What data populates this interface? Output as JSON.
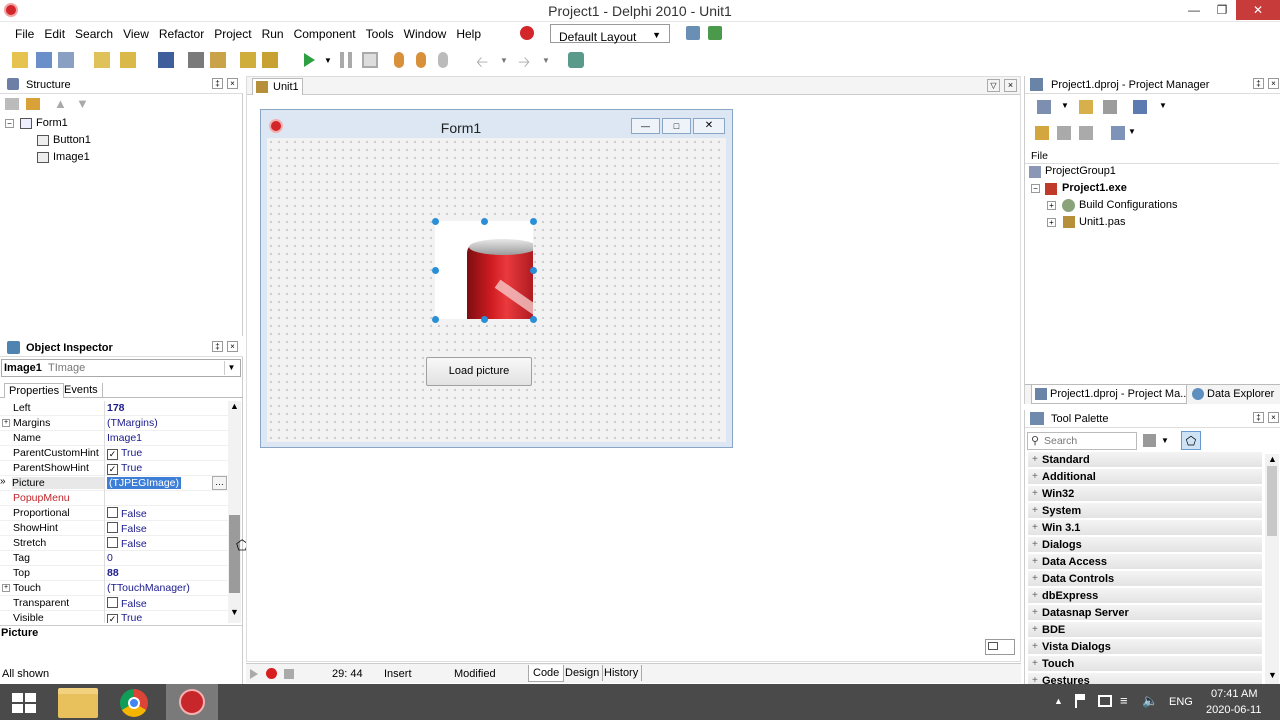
{
  "window": {
    "title": "Project1 - Delphi 2010 - Unit1"
  },
  "menu": [
    "File",
    "Edit",
    "Search",
    "View",
    "Refactor",
    "Project",
    "Run",
    "Component",
    "Tools",
    "Window",
    "Help"
  ],
  "layout_select": "Default Layout",
  "structure": {
    "title": "Structure",
    "root": "Form1",
    "children": [
      "Button1",
      "Image1"
    ]
  },
  "editor": {
    "tab": "Unit1",
    "form_caption": "Form1",
    "button_label": "Load picture"
  },
  "inspector": {
    "title": "Object Inspector",
    "selected_name": "Image1",
    "selected_type": "TImage",
    "tabs": [
      "Properties",
      "Events"
    ],
    "rows": [
      {
        "name": "Left",
        "value": "178",
        "bold": true
      },
      {
        "name": "Margins",
        "value": "(TMargins)",
        "expand": true
      },
      {
        "name": "Name",
        "value": "Image1"
      },
      {
        "name": "ParentCustomHint",
        "value": "True",
        "check": true,
        "checked": true
      },
      {
        "name": "ParentShowHint",
        "value": "True",
        "check": true,
        "checked": true
      },
      {
        "name": "Picture",
        "value": "(TJPEGImage)",
        "selected": true
      },
      {
        "name": "PopupMenu",
        "value": "",
        "red": true
      },
      {
        "name": "Proportional",
        "value": "False",
        "check": true,
        "checked": false
      },
      {
        "name": "ShowHint",
        "value": "False",
        "check": true,
        "checked": false
      },
      {
        "name": "Stretch",
        "value": "False",
        "check": true,
        "checked": false
      },
      {
        "name": "Tag",
        "value": "0"
      },
      {
        "name": "Top",
        "value": "88",
        "bold": true
      },
      {
        "name": "Touch",
        "value": "(TTouchManager)",
        "expand": true
      },
      {
        "name": "Transparent",
        "value": "False",
        "check": true,
        "checked": false
      },
      {
        "name": "Visible",
        "value": "True",
        "check": true,
        "checked": true
      }
    ],
    "desc": "Picture",
    "status": "All shown"
  },
  "project_manager": {
    "title": "Project1.dproj - Project Manager",
    "column": "File",
    "group": "ProjectGroup1",
    "project": "Project1.exe",
    "items": [
      "Build Configurations",
      "Unit1.pas"
    ],
    "tabs": [
      "Project1.dproj - Project Ma...",
      "Data Explorer"
    ]
  },
  "tool_palette": {
    "title": "Tool Palette",
    "search_placeholder": "Search",
    "categories": [
      "Standard",
      "Additional",
      "Win32",
      "System",
      "Win 3.1",
      "Dialogs",
      "Data Access",
      "Data Controls",
      "dbExpress",
      "Datasnap Server",
      "BDE",
      "Vista Dialogs",
      "Touch",
      "Gestures"
    ]
  },
  "statusbar": {
    "position": "29: 44",
    "mode": "Insert",
    "state": "Modified",
    "tabs": [
      "Code",
      "Design",
      "History"
    ]
  },
  "taskbar": {
    "lang": "ENG",
    "time": "07:41 AM",
    "date": "2020-06-11"
  }
}
